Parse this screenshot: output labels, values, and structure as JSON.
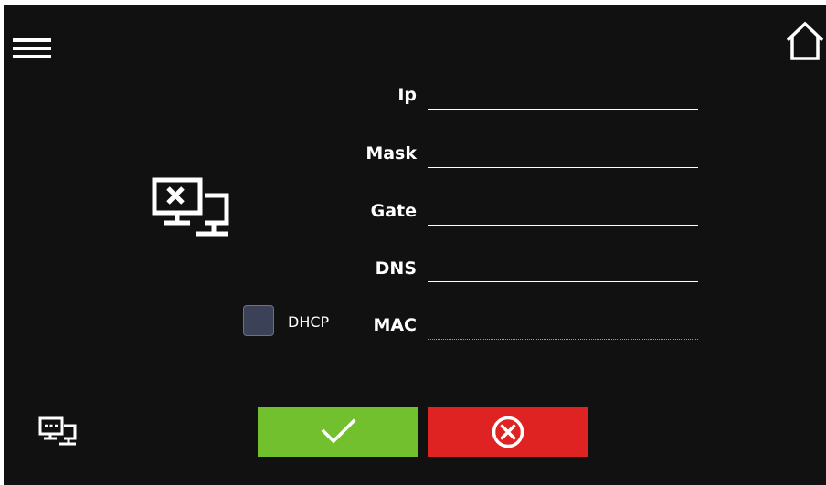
{
  "header": {
    "menu_icon": "hamburger-menu-icon",
    "home_icon": "home-icon"
  },
  "network_status_icon": "network-disconnected-icon",
  "fields": [
    {
      "label": "Ip",
      "value": ""
    },
    {
      "label": "Mask",
      "value": ""
    },
    {
      "label": "Gate",
      "value": ""
    },
    {
      "label": "DNS",
      "value": ""
    },
    {
      "label": "MAC",
      "value": ""
    }
  ],
  "dhcp": {
    "label": "DHCP",
    "checked": false
  },
  "footer": {
    "network_icon": "network-settings-icon",
    "confirm_icon": "check-icon",
    "cancel_icon": "cancel-circle-x-icon"
  },
  "colors": {
    "background": "#111111",
    "confirm": "#73c02e",
    "cancel": "#df2222",
    "checkbox": "#3b4157",
    "text": "#ffffff"
  }
}
